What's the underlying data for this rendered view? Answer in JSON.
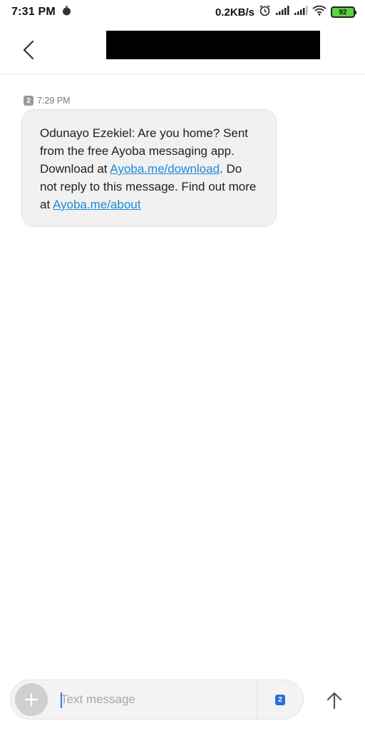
{
  "status_bar": {
    "time": "7:31 PM",
    "net_speed": "0.2KB/s",
    "battery_level": "92",
    "icons": [
      "notification-dot-icon",
      "alarm-icon",
      "signal-icon",
      "signal-icon",
      "wifi-icon",
      "battery-icon"
    ]
  },
  "header": {
    "back_icon": "chevron-left-icon"
  },
  "message": {
    "sim": "2",
    "time": "7:29 PM",
    "line1": "Odunayo Ezekiel: Are you home? Sent from the free Ayoba messaging app. Download at ",
    "link1": "Ayoba.me/download",
    "line2": ". Do not reply to this message. Find out more at ",
    "link2": "Ayoba.me/about"
  },
  "composer": {
    "placeholder": "Text message",
    "sim_label": "2",
    "attach_icon": "plus-icon",
    "send_icon": "arrow-up-icon"
  },
  "colors": {
    "link": "#1f8ad8",
    "bubble_bg": "#f1f1f1",
    "sim_badge_active": "#2a6ee0",
    "battery_fill": "#5cd33d"
  }
}
